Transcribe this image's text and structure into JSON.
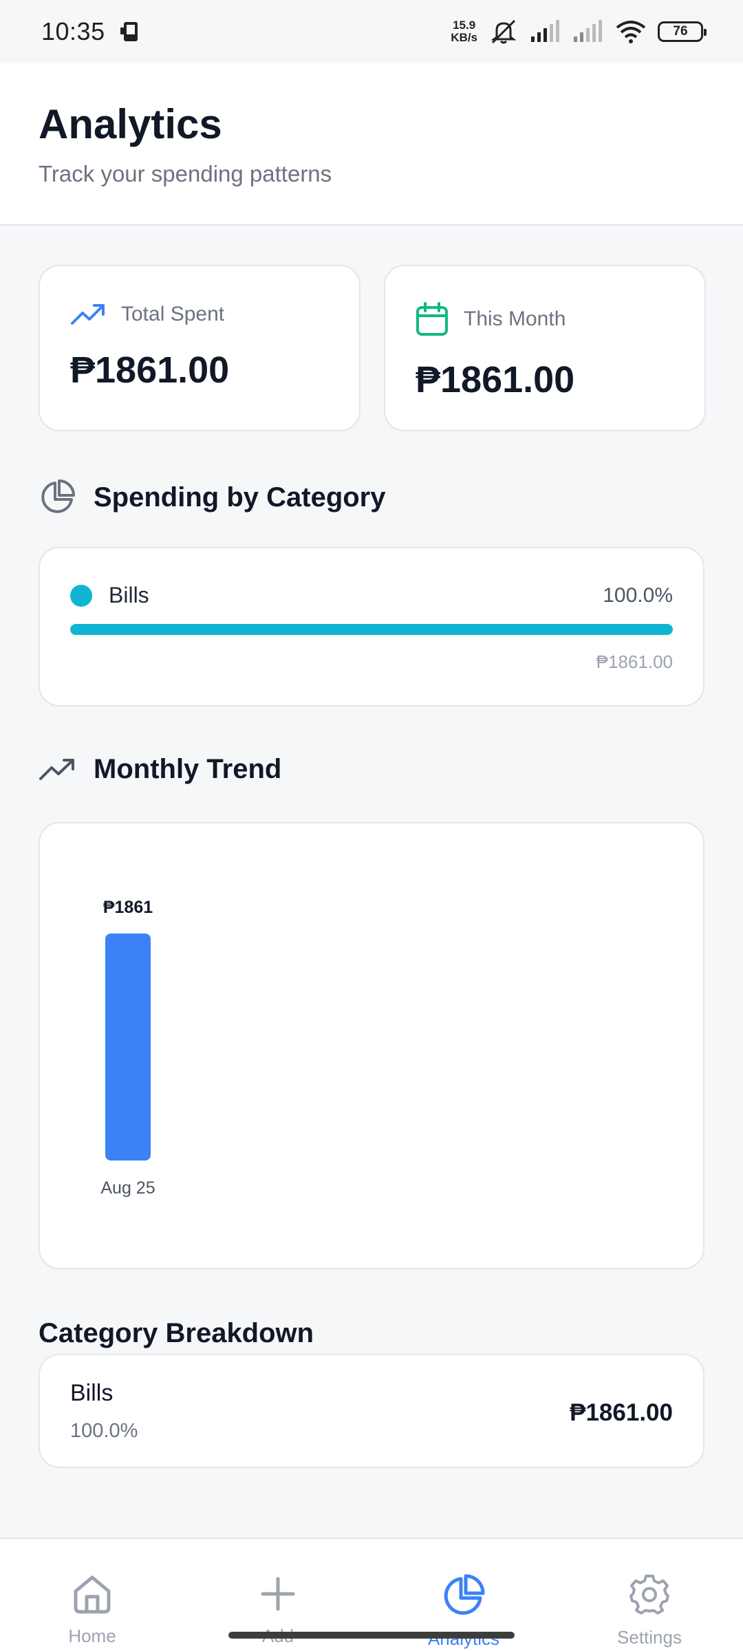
{
  "status_bar": {
    "time": "10:35",
    "speed_value": "15.9",
    "speed_unit": "KB/s",
    "battery": "76"
  },
  "header": {
    "title": "Analytics",
    "subtitle": "Track your spending patterns"
  },
  "stats": {
    "total_spent": {
      "label": "Total Spent",
      "value": "₱1861.00",
      "icon": "trending-up-icon",
      "color": "#3b82f6"
    },
    "this_month": {
      "label": "This Month",
      "value": "₱1861.00",
      "icon": "calendar-icon",
      "color": "#10b981"
    }
  },
  "spending_by_category": {
    "title": "Spending by Category",
    "items": [
      {
        "name": "Bills",
        "percent_label": "100.0%",
        "percent": 100,
        "amount": "₱1861.00",
        "color": "#0fb5d3"
      }
    ]
  },
  "monthly_trend": {
    "title": "Monthly Trend"
  },
  "chart_data": {
    "type": "bar",
    "categories": [
      "Aug 25"
    ],
    "values": [
      1861
    ],
    "data_labels": [
      "₱1861"
    ],
    "bar_color": "#3b82f6",
    "title": "",
    "xlabel": "",
    "ylabel": "",
    "grid": false
  },
  "category_breakdown": {
    "title": "Category Breakdown",
    "items": [
      {
        "name": "Bills",
        "percent": "100.0%",
        "amount": "₱1861.00"
      }
    ]
  },
  "nav": {
    "items": [
      {
        "label": "Home",
        "icon": "home-icon",
        "active": false
      },
      {
        "label": "Add",
        "icon": "plus-icon",
        "active": false
      },
      {
        "label": "Analytics",
        "icon": "pie-chart-icon",
        "active": true
      },
      {
        "label": "Settings",
        "icon": "gear-icon",
        "active": false
      }
    ],
    "active_color": "#3b82f6"
  }
}
